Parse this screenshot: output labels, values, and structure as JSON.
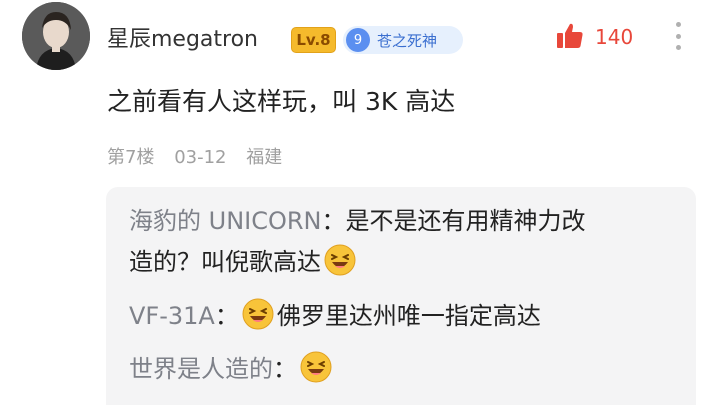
{
  "post": {
    "username": "星辰megatron",
    "level": "Lv.8",
    "title_badge": {
      "number": "9",
      "text": "苍之死神"
    },
    "likes": "140",
    "content": "之前看有人这样玩，叫 3K 高达",
    "floor": "第7楼",
    "date": "03-12",
    "location": "福建"
  },
  "replies": [
    {
      "author": "海豹的 UNICORN",
      "sep": "：",
      "text_line1": "是不是还有用精神力改",
      "text_line2": "造的？叫倪歌高达",
      "emoji": "laughing-emoji"
    },
    {
      "author": "VF-31A",
      "sep": "：",
      "text": "佛罗里达州唯一指定高达",
      "emoji": "laughing-emoji"
    },
    {
      "author": "世界是人造的",
      "sep": "：",
      "text": "",
      "emoji": "laughing-emoji"
    }
  ],
  "colors": {
    "like": "#e8473a",
    "level_badge": "#f5ba2c",
    "title_badge_bg": "#e6f0fd",
    "reply_author": "#7e8189",
    "meta": "#a0a0a0"
  }
}
